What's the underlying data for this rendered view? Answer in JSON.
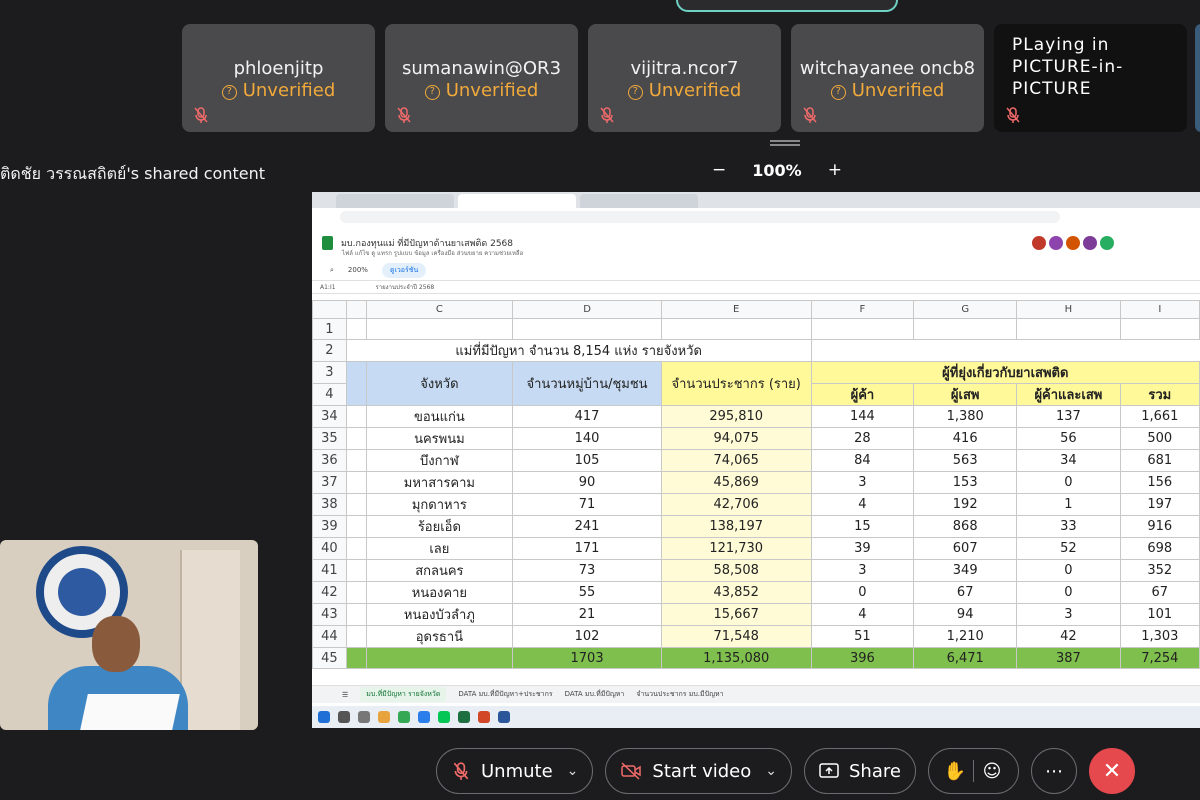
{
  "participants": [
    {
      "name": "phloenjitp",
      "status": "Unverified"
    },
    {
      "name": "sumanawin@OR3",
      "status": "Unverified"
    },
    {
      "name": "vijitra.ncor7",
      "status": "Unverified"
    },
    {
      "name": "witchayanee oncb8",
      "status": "Unverified"
    }
  ],
  "pip_tile": {
    "line1": "PLaying in",
    "line2": "PICTURE-in-",
    "line3": "PICTURE"
  },
  "shared_label": "ติดชัย วรรณสถิตย์'s shared content",
  "zoom": {
    "minus": "−",
    "value": "100%",
    "plus": "+"
  },
  "sheet": {
    "doc_title": "มบ.กองทุนแม่ ที่มีปัญหาด้านยาเสพติด 2568",
    "doc_menu": "ไฟล์   แก้ไข   ดู   แทรก   รูปแบบ   ข้อมูล   เครื่องมือ   ส่วนขยาย   ความช่วยเหลือ",
    "zoom_level": "200%",
    "mode_label": "ดูเวอร์ชัน",
    "cell_ref": "A1:I1",
    "formula": "รายงานประจำปี 2568",
    "col_headers": [
      "C",
      "D",
      "E",
      "F",
      "G",
      "H",
      "I"
    ],
    "title_row": "แม่ที่มีปัญหา จำนวน 8,154 แห่ง รายจังหวัด",
    "hdr_province": "จังหวัด",
    "hdr_villages": "จำนวนหมู่บ้าน/ชุมชน",
    "hdr_population": "จำนวนประชากร (ราย)",
    "hdr_involved": "ผู้ที่ยุ่งเกี่ยวกับยาเสพติด",
    "sub_seller": "ผู้ค้า",
    "sub_user": "ผู้เสพ",
    "sub_both": "ผู้ค้าและเสพ",
    "sub_total": "รวม",
    "rows": [
      {
        "n": "34",
        "prov": "ขอนแก่น",
        "vil": "417",
        "pop": "295,810",
        "f": "144",
        "g": "1,380",
        "h": "137",
        "i": "1,661"
      },
      {
        "n": "35",
        "prov": "นครพนม",
        "vil": "140",
        "pop": "94,075",
        "f": "28",
        "g": "416",
        "h": "56",
        "i": "500"
      },
      {
        "n": "36",
        "prov": "บึงกาฬ",
        "vil": "105",
        "pop": "74,065",
        "f": "84",
        "g": "563",
        "h": "34",
        "i": "681"
      },
      {
        "n": "37",
        "prov": "มหาสารคาม",
        "vil": "90",
        "pop": "45,869",
        "f": "3",
        "g": "153",
        "h": "0",
        "i": "156"
      },
      {
        "n": "38",
        "prov": "มุกดาหาร",
        "vil": "71",
        "pop": "42,706",
        "f": "4",
        "g": "192",
        "h": "1",
        "i": "197"
      },
      {
        "n": "39",
        "prov": "ร้อยเอ็ด",
        "vil": "241",
        "pop": "138,197",
        "f": "15",
        "g": "868",
        "h": "33",
        "i": "916"
      },
      {
        "n": "40",
        "prov": "เลย",
        "vil": "171",
        "pop": "121,730",
        "f": "39",
        "g": "607",
        "h": "52",
        "i": "698"
      },
      {
        "n": "41",
        "prov": "สกลนคร",
        "vil": "73",
        "pop": "58,508",
        "f": "3",
        "g": "349",
        "h": "0",
        "i": "352"
      },
      {
        "n": "42",
        "prov": "หนองคาย",
        "vil": "55",
        "pop": "43,852",
        "f": "0",
        "g": "67",
        "h": "0",
        "i": "67"
      },
      {
        "n": "43",
        "prov": "หนองบัวลำภู",
        "vil": "21",
        "pop": "15,667",
        "f": "4",
        "g": "94",
        "h": "3",
        "i": "101"
      },
      {
        "n": "44",
        "prov": "อุดรธานี",
        "vil": "102",
        "pop": "71,548",
        "f": "51",
        "g": "1,210",
        "h": "42",
        "i": "1,303"
      }
    ],
    "total": {
      "n": "45",
      "vil": "1703",
      "pop": "1,135,080",
      "f": "396",
      "g": "6,471",
      "h": "387",
      "i": "7,254"
    },
    "tabs": [
      "มบ.ที่มีปัญหา รายจังหวัด",
      "DATA มบ.ที่มีปัญหา+ประชากร",
      "DATA มบ.ที่มีปัญหา",
      "จำนวนประชากร มบ.มีปัญหา"
    ]
  },
  "controls": {
    "unmute": "Unmute",
    "start_video": "Start video",
    "share": "Share"
  },
  "colors": {
    "unverified": "#f0a93a",
    "end_call": "#e5484d",
    "header_blue": "#c6dbf3",
    "header_yellow": "#fff99a",
    "total_green": "#7fbf4d"
  }
}
